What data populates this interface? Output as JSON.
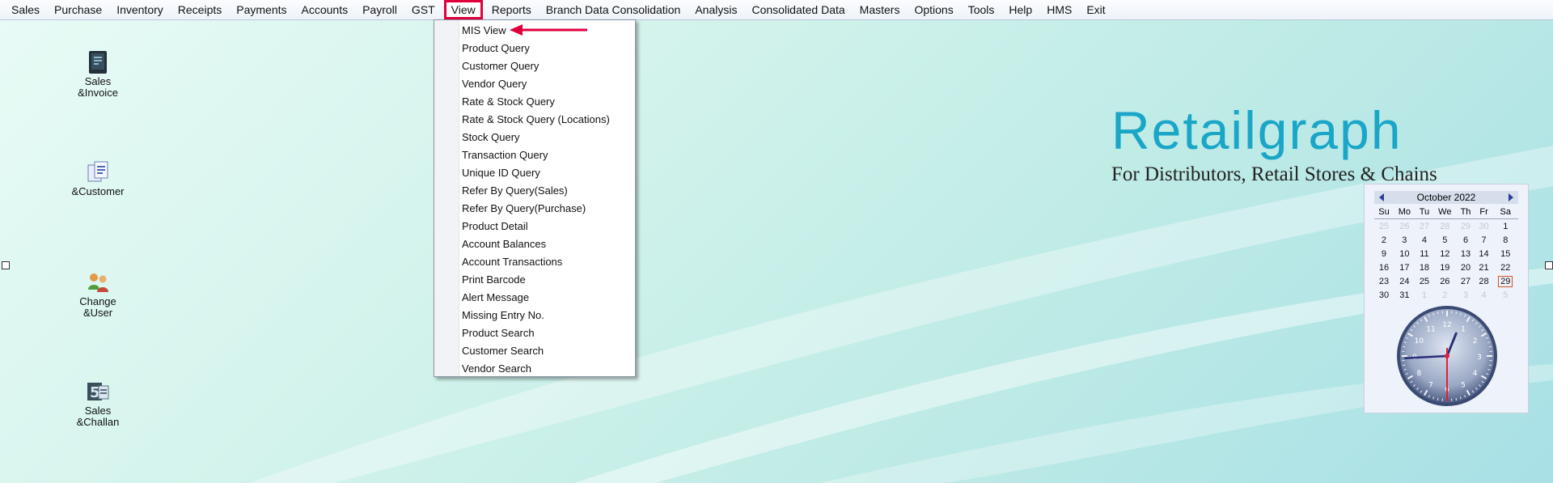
{
  "menubar": {
    "items": [
      "Sales",
      "Purchase",
      "Inventory",
      "Receipts",
      "Payments",
      "Accounts",
      "Payroll",
      "GST",
      "View",
      "Reports",
      "Branch Data Consolidation",
      "Analysis",
      "Consolidated Data",
      "Masters",
      "Options",
      "Tools",
      "Help",
      "HMS",
      "Exit"
    ],
    "active": "View"
  },
  "desktop": {
    "icons": [
      {
        "label": "Sales\n&Invoice",
        "icon": "invoice-book-icon"
      },
      {
        "label": "&Customer",
        "icon": "customer-documents-icon"
      },
      {
        "label": "Change\n&User",
        "icon": "users-icon"
      },
      {
        "label": "Sales\n&Challan",
        "icon": "challan-icon"
      }
    ]
  },
  "brand": {
    "logo_text": "Retailgraph",
    "tagline": "For Distributors, Retail Stores & Chains",
    "logo_color": "#1aa6c7"
  },
  "view_menu": {
    "items": [
      "MIS View",
      "Product Query",
      "Customer Query",
      "Vendor Query",
      "Rate & Stock Query",
      "Rate & Stock Query (Locations)",
      "Stock Query",
      "Transaction Query",
      "Unique ID Query",
      "Refer By Query(Sales)",
      "Refer By Query(Purchase)",
      "Product Detail",
      "Account Balances",
      "Account Transactions",
      "Print Barcode",
      "Alert Message",
      "Missing Entry No.",
      "Product Search",
      "Customer Search",
      "Vendor Search"
    ],
    "highlighted": "MIS View",
    "annotation_color": "#e0003c"
  },
  "calendar": {
    "month_label": "October  2022",
    "weekdays": [
      "Su",
      "Mo",
      "Tu",
      "We",
      "Th",
      "Fr",
      "Sa"
    ],
    "weeks": [
      [
        "25",
        "26",
        "27",
        "28",
        "29",
        "30",
        "1"
      ],
      [
        "2",
        "3",
        "4",
        "5",
        "6",
        "7",
        "8"
      ],
      [
        "9",
        "10",
        "11",
        "12",
        "13",
        "14",
        "15"
      ],
      [
        "16",
        "17",
        "18",
        "19",
        "20",
        "21",
        "22"
      ],
      [
        "23",
        "24",
        "25",
        "26",
        "27",
        "28",
        "29"
      ],
      [
        "30",
        "31",
        "1",
        "2",
        "3",
        "4",
        "5"
      ]
    ],
    "today": "29"
  },
  "clock": {
    "hour": 12,
    "minute": 44,
    "second": 30
  }
}
